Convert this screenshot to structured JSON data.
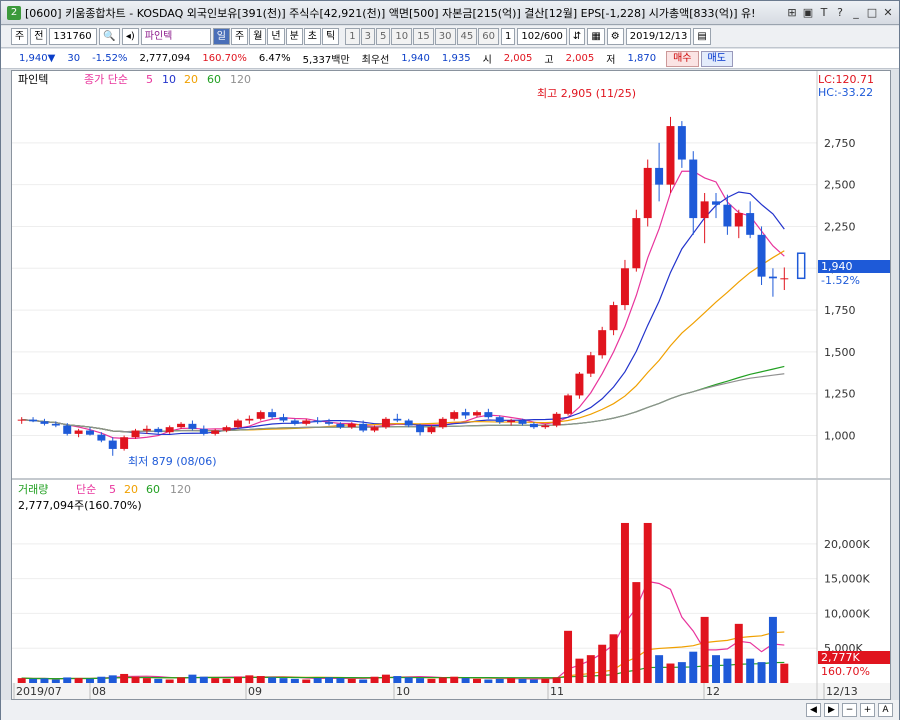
{
  "window": {
    "title": "[0600] 키움종합차트 - KOSDAQ 외국인보유[391(천)] 주식수[42,921(천)] 액면[500] 자본금[215(억)] 결산[12월] EPS[-1,228] 시가총액[833(억)] 유!",
    "icon_label": "2"
  },
  "toolbar": {
    "period": "주",
    "mode": "전",
    "code": "131760",
    "name": "파인텍",
    "tabs": [
      "일",
      "주",
      "월",
      "년",
      "분",
      "초",
      "틱"
    ],
    "minute_steps": [
      "1",
      "3",
      "5",
      "10",
      "15",
      "30",
      "45",
      "60"
    ],
    "unit": "1",
    "count": "102/600",
    "date": "2019/12/13"
  },
  "quote": {
    "price": "1,940▼",
    "change": "30",
    "change_pct": "-1.52%",
    "volume": "2,777,094",
    "vol_ratio": "160.70%",
    "turnover": "6.47%",
    "amount": "5,337백만",
    "best_label": "최우선",
    "best_ask": "1,940",
    "best_bid": "1,935",
    "open_label": "시",
    "open": "2,005",
    "high_label": "고",
    "high": "2,005",
    "low_label": "저",
    "low": "1,870",
    "buy": "매수",
    "sell": "매도"
  },
  "price_panel": {
    "stock_label": "파인텍",
    "ma_label": "종가 단순",
    "periods": [
      "5",
      "10",
      "20",
      "60",
      "120"
    ],
    "lc": "LC:120.71",
    "hc": "HC:-33.22",
    "high_annot": "최고 2,905 (11/25)",
    "low_annot": "최저 879 (08/06)",
    "last_price": "1,940",
    "last_pct": "-1.52%",
    "y_ticks": [
      "2,750",
      "2,500",
      "2,250",
      "2,000",
      "1,750",
      "1,500",
      "1,250",
      "1,000"
    ]
  },
  "volume_panel": {
    "label": "거래량",
    "ma_label": "단순",
    "periods": [
      "5",
      "20",
      "60",
      "120"
    ],
    "value_text": "2,777,094주(160.70%)",
    "last": "2,777K",
    "last_pct": "160.70%",
    "y_ticks": [
      "20,000K",
      "15,000K",
      "10,000K",
      "5,000K"
    ]
  },
  "x_axis": {
    "labels": [
      "2019/07",
      "08",
      "09",
      "10",
      "11",
      "12",
      "12/13"
    ]
  },
  "colors": {
    "up": "#e0141e",
    "down": "#1e5ad8",
    "ma5": "#e8349c",
    "ma10": "#2233cc",
    "ma20": "#f0a000",
    "ma60": "#22a022",
    "ma120": "#909090"
  },
  "chart_data": {
    "type": "candlestick",
    "ohlc_daily_approx": [
      [
        1090,
        1110,
        1070,
        1095
      ],
      [
        1095,
        1110,
        1080,
        1085
      ],
      [
        1085,
        1100,
        1060,
        1070
      ],
      [
        1070,
        1085,
        1050,
        1060
      ],
      [
        1060,
        1075,
        1000,
        1010
      ],
      [
        1010,
        1040,
        990,
        1030
      ],
      [
        1030,
        1050,
        1000,
        1005
      ],
      [
        1005,
        1020,
        960,
        970
      ],
      [
        970,
        990,
        879,
        920
      ],
      [
        920,
        1000,
        910,
        990
      ],
      [
        990,
        1040,
        980,
        1030
      ],
      [
        1030,
        1060,
        1010,
        1040
      ],
      [
        1040,
        1050,
        1010,
        1020
      ],
      [
        1020,
        1060,
        1010,
        1050
      ],
      [
        1050,
        1080,
        1040,
        1070
      ],
      [
        1070,
        1090,
        1030,
        1040
      ],
      [
        1040,
        1060,
        1000,
        1010
      ],
      [
        1010,
        1040,
        1000,
        1030
      ],
      [
        1030,
        1060,
        1020,
        1050
      ],
      [
        1050,
        1100,
        1040,
        1090
      ],
      [
        1090,
        1120,
        1070,
        1100
      ],
      [
        1100,
        1150,
        1090,
        1140
      ],
      [
        1140,
        1160,
        1100,
        1110
      ],
      [
        1110,
        1130,
        1080,
        1090
      ],
      [
        1090,
        1100,
        1060,
        1070
      ],
      [
        1070,
        1100,
        1060,
        1090
      ],
      [
        1090,
        1110,
        1070,
        1080
      ],
      [
        1080,
        1100,
        1060,
        1070
      ],
      [
        1070,
        1080,
        1040,
        1050
      ],
      [
        1050,
        1080,
        1040,
        1070
      ],
      [
        1070,
        1090,
        1020,
        1030
      ],
      [
        1030,
        1060,
        1020,
        1050
      ],
      [
        1050,
        1110,
        1040,
        1100
      ],
      [
        1100,
        1130,
        1080,
        1090
      ],
      [
        1090,
        1100,
        1050,
        1060
      ],
      [
        1060,
        1070,
        1000,
        1020
      ],
      [
        1020,
        1060,
        1010,
        1050
      ],
      [
        1050,
        1110,
        1040,
        1100
      ],
      [
        1100,
        1150,
        1090,
        1140
      ],
      [
        1140,
        1160,
        1100,
        1120
      ],
      [
        1120,
        1150,
        1110,
        1140
      ],
      [
        1140,
        1160,
        1100,
        1110
      ],
      [
        1110,
        1120,
        1070,
        1080
      ],
      [
        1080,
        1100,
        1060,
        1090
      ],
      [
        1090,
        1100,
        1060,
        1070
      ],
      [
        1070,
        1080,
        1040,
        1050
      ],
      [
        1050,
        1070,
        1040,
        1060
      ],
      [
        1060,
        1140,
        1050,
        1130
      ],
      [
        1130,
        1250,
        1120,
        1240
      ],
      [
        1240,
        1380,
        1220,
        1370
      ],
      [
        1370,
        1500,
        1350,
        1480
      ],
      [
        1480,
        1650,
        1460,
        1630
      ],
      [
        1630,
        1800,
        1600,
        1780
      ],
      [
        1780,
        2050,
        1750,
        2000
      ],
      [
        2000,
        2350,
        1980,
        2300
      ],
      [
        2300,
        2650,
        2250,
        2600
      ],
      [
        2600,
        2750,
        2400,
        2500
      ],
      [
        2500,
        2905,
        2450,
        2850
      ],
      [
        2850,
        2880,
        2600,
        2650
      ],
      [
        2650,
        2700,
        2200,
        2300
      ],
      [
        2300,
        2450,
        2150,
        2400
      ],
      [
        2400,
        2450,
        2300,
        2380
      ],
      [
        2380,
        2440,
        2200,
        2250
      ],
      [
        2250,
        2350,
        2180,
        2330
      ],
      [
        2330,
        2400,
        2180,
        2200
      ],
      [
        2200,
        2250,
        1900,
        1950
      ],
      [
        1950,
        2000,
        1830,
        1940
      ],
      [
        1940,
        2005,
        1870,
        1940
      ]
    ],
    "volume_k_approx": [
      700,
      600,
      650,
      500,
      800,
      700,
      600,
      900,
      1100,
      1300,
      900,
      700,
      600,
      500,
      800,
      1200,
      900,
      700,
      600,
      900,
      1100,
      1000,
      800,
      700,
      600,
      500,
      700,
      800,
      700,
      600,
      500,
      900,
      1200,
      1000,
      800,
      700,
      600,
      800,
      900,
      700,
      600,
      500,
      600,
      700,
      600,
      500,
      600,
      800,
      7500,
      3500,
      4000,
      5500,
      7000,
      23000,
      14500,
      23000,
      4000,
      2800,
      3000,
      4500,
      9500,
      4000,
      3500,
      8500,
      3500,
      3000,
      9500,
      2777
    ],
    "ylim": [
      800,
      3000
    ]
  }
}
